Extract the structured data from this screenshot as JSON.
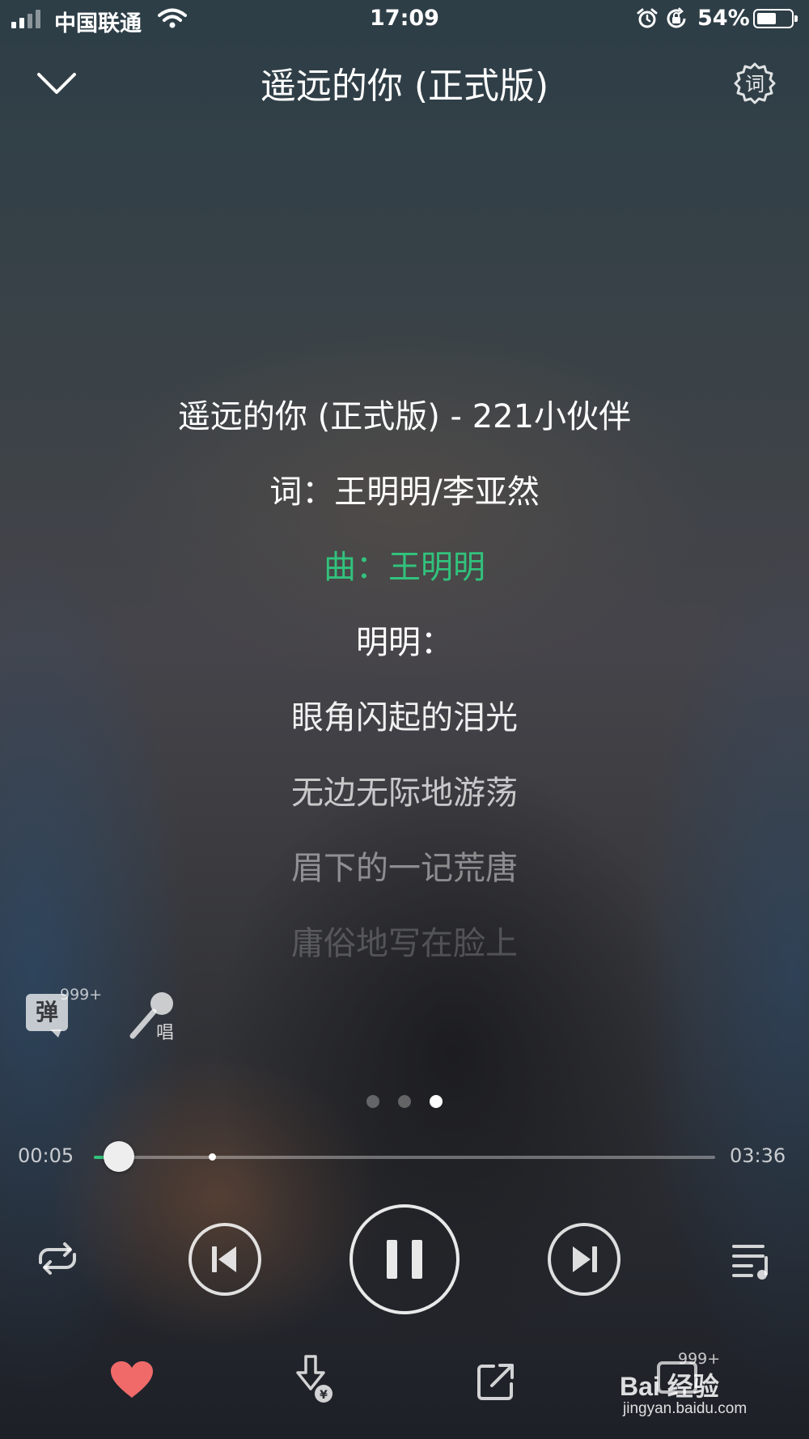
{
  "status_bar": {
    "carrier": "中国联通",
    "time": "17:09",
    "battery_percent": "54%",
    "battery_level": 0.54,
    "icons": [
      "signal-icon",
      "wifi-icon",
      "alarm-icon",
      "rotation-lock-icon",
      "battery-icon"
    ]
  },
  "header": {
    "title": "遥远的你 (正式版)",
    "lyrics_settings_label": "词"
  },
  "lyrics": {
    "lines": [
      {
        "text": "遥远的你 (正式版) - 221小伙伴",
        "color": "#ffffff",
        "opacity": 1.0
      },
      {
        "text": "词：王明明/李亚然",
        "color": "#ffffff",
        "opacity": 1.0
      },
      {
        "text": "曲：王明明",
        "color": "#31c27c",
        "opacity": 1.0
      },
      {
        "text": "明明：",
        "color": "#ffffff",
        "opacity": 1.0
      },
      {
        "text": "眼角闪起的泪光",
        "color": "#ffffff",
        "opacity": 0.92
      },
      {
        "text": "无边无际地游荡",
        "color": "#ffffff",
        "opacity": 0.72
      },
      {
        "text": "眉下的一记荒唐",
        "color": "#ffffff",
        "opacity": 0.45
      },
      {
        "text": "庸俗地写在脸上",
        "color": "#ffffff",
        "opacity": 0.2
      }
    ]
  },
  "side_buttons": {
    "danmu_label": "弹",
    "danmu_count": "999+",
    "sing_label": "唱"
  },
  "pager": {
    "pages": 3,
    "active": 2
  },
  "progress": {
    "current": "00:05",
    "total": "03:36",
    "played_fraction": 0.04,
    "buffered_fraction": 0.19
  },
  "controls": {
    "icons": [
      "repeat-icon",
      "previous-icon",
      "pause-icon",
      "next-icon",
      "playlist-icon"
    ]
  },
  "actions": {
    "icons": [
      "heart-icon",
      "download-paid-icon",
      "share-icon",
      "comment-icon"
    ],
    "comment_count": "999+",
    "heart_color": "#f06a6a"
  },
  "watermark": {
    "text": "Bai 经验",
    "sub": "jingyan.baidu.com"
  },
  "colors": {
    "accent": "#31c27c"
  }
}
